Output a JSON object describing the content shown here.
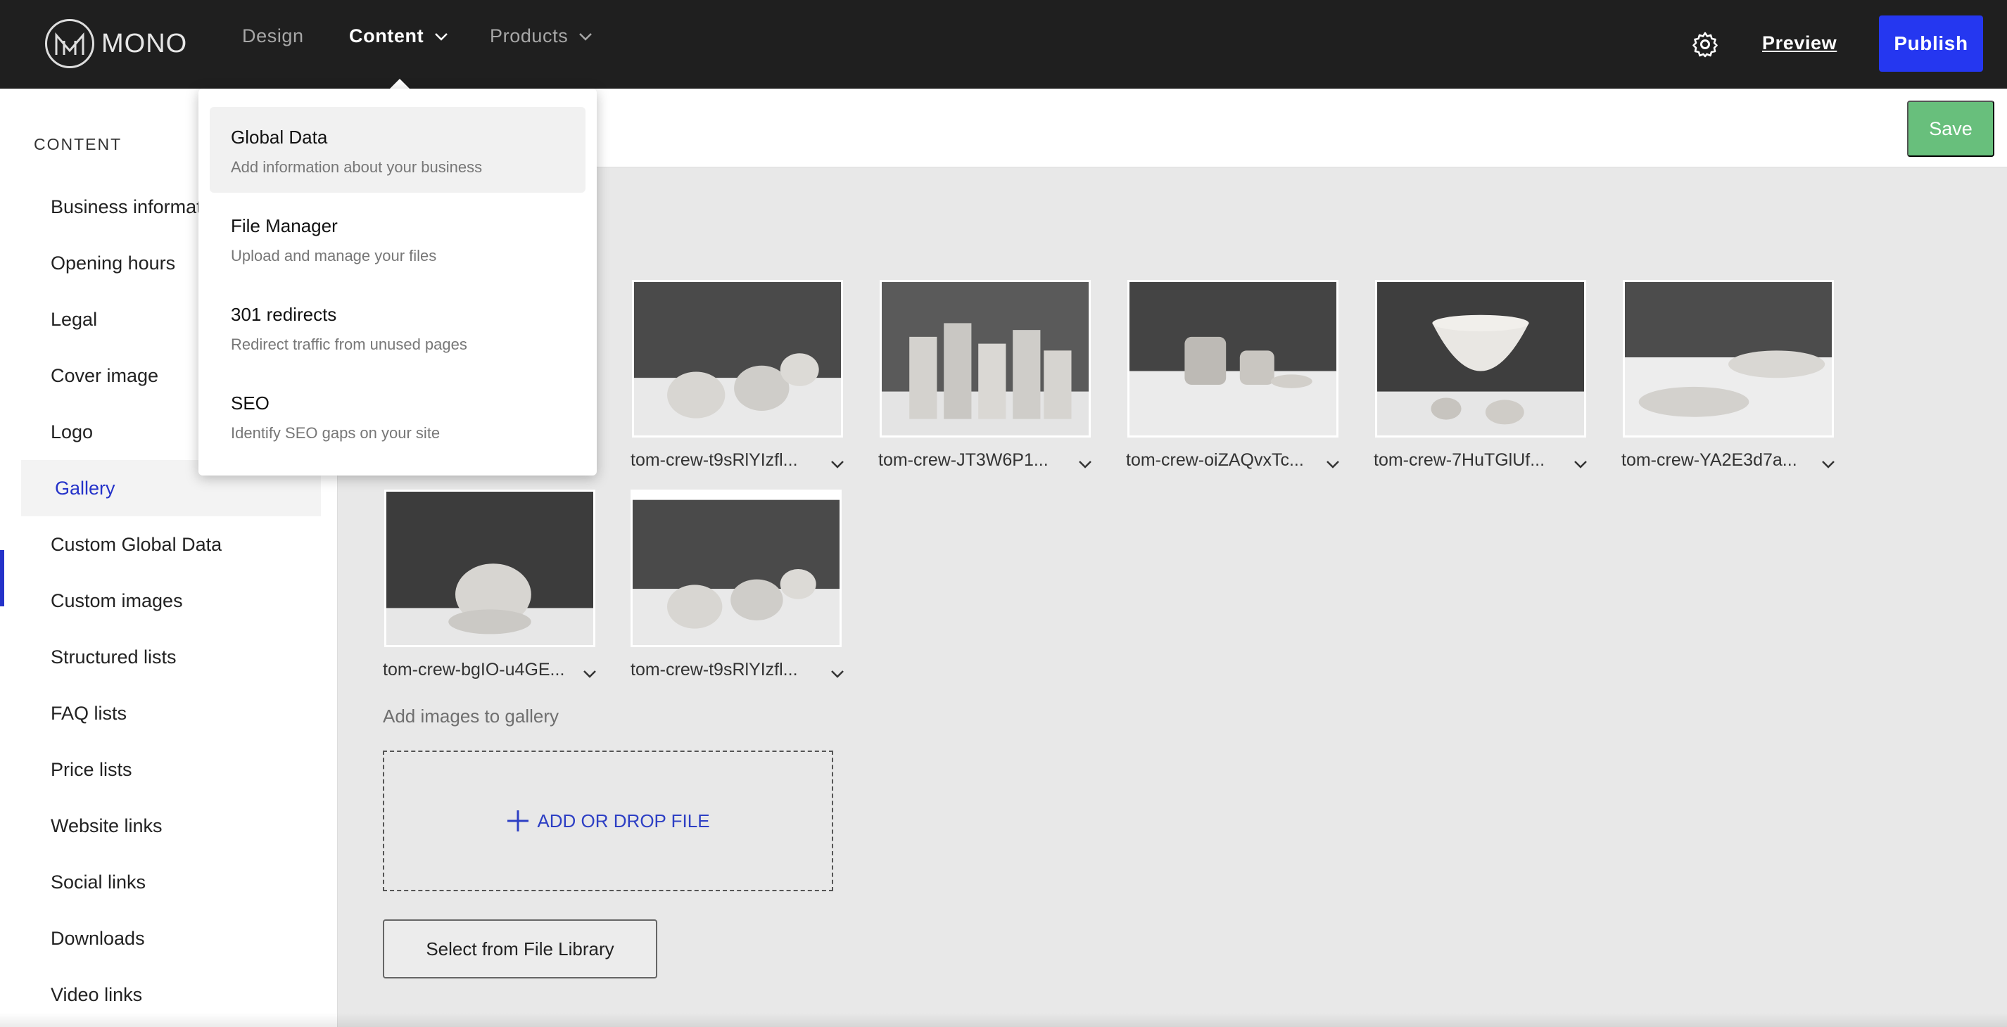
{
  "header": {
    "logo_text": "MONO",
    "nav": [
      {
        "label": "Design"
      },
      {
        "label": "Content"
      },
      {
        "label": "Products"
      }
    ],
    "preview_label": "Preview",
    "publish_label": "Publish",
    "brand_color": "#2537f0"
  },
  "content_menu": {
    "items": [
      {
        "title": "Global Data",
        "description": "Add information about your business"
      },
      {
        "title": "File Manager",
        "description": "Upload and manage your files"
      },
      {
        "title": "301 redirects",
        "description": "Redirect traffic from unused pages"
      },
      {
        "title": "SEO",
        "description": "Identify SEO gaps on your site"
      }
    ]
  },
  "sidebar": {
    "heading": "CONTENT",
    "items": [
      {
        "label": "Business informat"
      },
      {
        "label": "Opening hours"
      },
      {
        "label": "Legal"
      },
      {
        "label": "Cover image"
      },
      {
        "label": "Logo"
      },
      {
        "label": "Gallery"
      },
      {
        "label": "Custom Global Data"
      },
      {
        "label": "Custom images"
      },
      {
        "label": "Structured lists"
      },
      {
        "label": "FAQ lists"
      },
      {
        "label": "Price lists"
      },
      {
        "label": "Website links"
      },
      {
        "label": "Social links"
      },
      {
        "label": "Downloads"
      },
      {
        "label": "Video links"
      }
    ],
    "active_item": "Gallery"
  },
  "toolbar": {
    "save_label": "Save",
    "save_color": "#68bf7c"
  },
  "gallery": {
    "images": [
      {
        "name": "tom-crew-t9sRlYIzfl..."
      },
      {
        "name": "tom-crew-JT3W6P1..."
      },
      {
        "name": "tom-crew-oiZAQvxTc..."
      },
      {
        "name": "tom-crew-7HuTGlUf..."
      },
      {
        "name": "tom-crew-YA2E3d7a..."
      },
      {
        "name": "tom-crew-bgIO-u4GE..."
      },
      {
        "name": "tom-crew-t9sRlYIzfl..."
      }
    ],
    "add_label": "Add images to gallery",
    "dropzone_label": "ADD OR DROP FILE",
    "library_button_label": "Select from File Library"
  }
}
